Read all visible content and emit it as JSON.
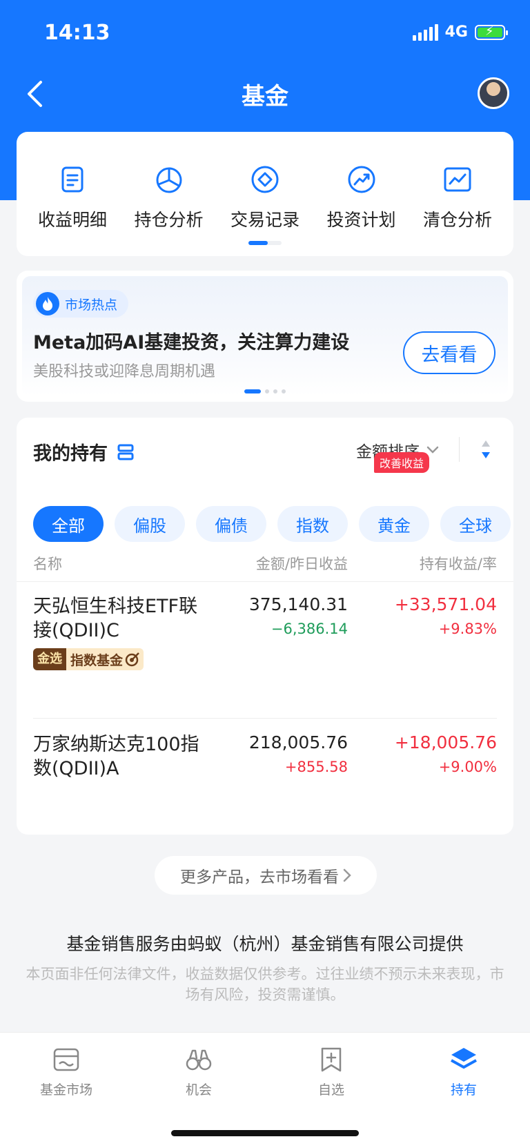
{
  "status": {
    "time": "14:13",
    "network": "4G"
  },
  "nav": {
    "title": "基金"
  },
  "tools": [
    {
      "label": "收益明细",
      "icon": "document-icon"
    },
    {
      "label": "持仓分析",
      "icon": "pie-chart-icon"
    },
    {
      "label": "交易记录",
      "icon": "diamond-icon"
    },
    {
      "label": "投资计划",
      "icon": "trend-circle-icon"
    },
    {
      "label": "清仓分析",
      "icon": "line-chart-icon"
    }
  ],
  "hot": {
    "tag": "市场热点",
    "title": "Meta加码AI基建投资，关注算力建设",
    "subtitle": "美股科技或迎降息周期机遇",
    "button": "去看看"
  },
  "holdings": {
    "title": "我的持有",
    "sort_label": "金额排序",
    "chips": [
      "全部",
      "偏股",
      "偏债",
      "指数",
      "黄金",
      "全球"
    ],
    "chip_badge": "改善收益",
    "columns": {
      "name": "名称",
      "amount": "金额/昨日收益",
      "profit": "持有收益/率"
    },
    "funds": [
      {
        "name": "天弘恒生科技ETF联接(QDII)C",
        "tag_gold": "金选",
        "tag_text": "指数基金",
        "amount": "375,140.31",
        "day_profit": "−6,386.14",
        "hold_profit": "+33,571.04",
        "hold_rate": "+9.83%"
      },
      {
        "name": "万家纳斯达克100指数(QDII)A",
        "amount": "218,005.76",
        "day_profit": "+855.58",
        "hold_profit": "+18,005.76",
        "hold_rate": "+9.00%"
      }
    ]
  },
  "more_button": "更多产品，去市场看看",
  "provider": "基金销售服务由蚂蚁（杭州）基金销售有限公司提供",
  "disclaimer": "本页面非任何法律文件，收益数据仅供参考。过往业绩不预示未来表现，市场有风险，投资需谨慎。",
  "tabbar": [
    {
      "label": "基金市场",
      "icon": "market-icon"
    },
    {
      "label": "机会",
      "icon": "binoculars-icon"
    },
    {
      "label": "自选",
      "icon": "bookmark-add-icon"
    },
    {
      "label": "持有",
      "icon": "layers-icon"
    }
  ],
  "colors": {
    "brand": "#1677ff",
    "gain": "#f12f3f",
    "loss": "#1e9c5a"
  }
}
